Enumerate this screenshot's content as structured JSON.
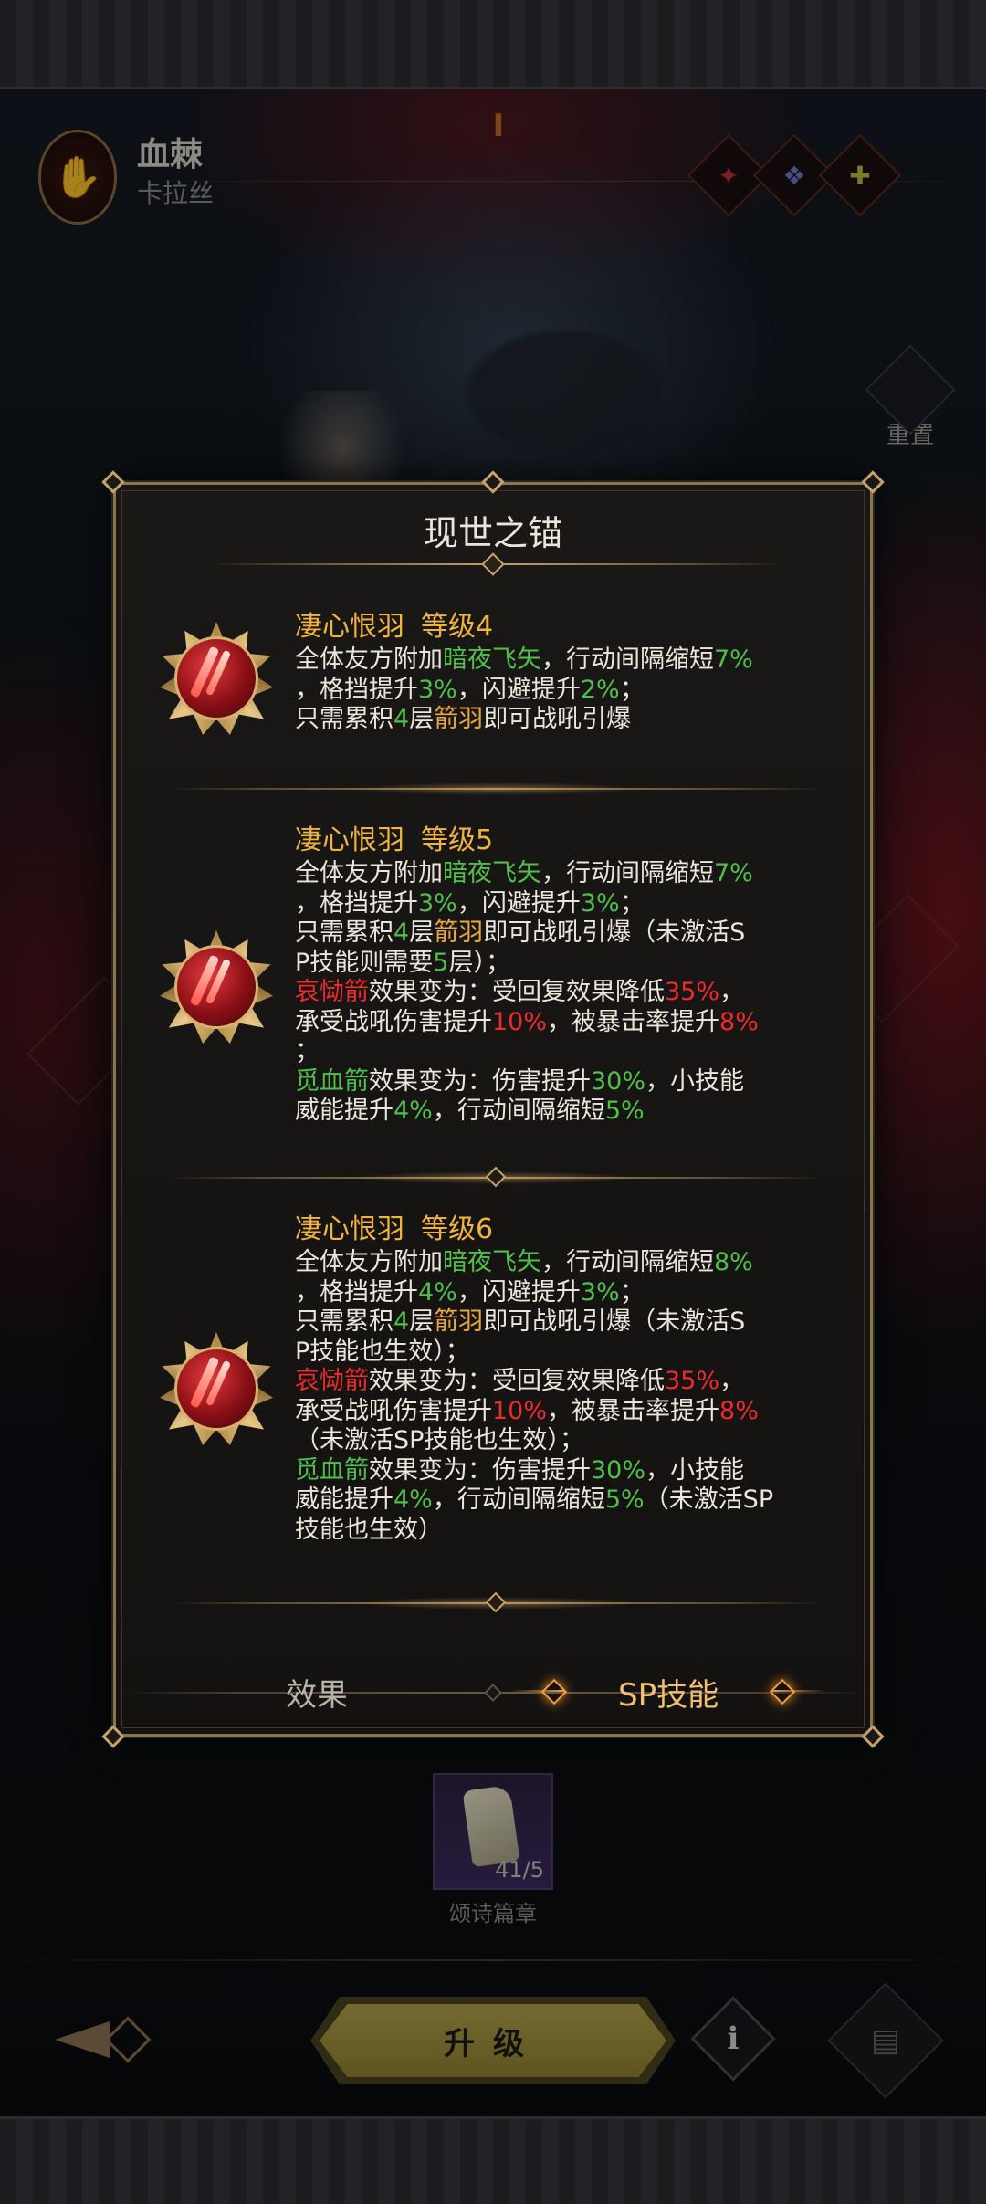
{
  "header": {
    "hero_emblem_icon": "red-hand-icon",
    "hero_name": "血棘",
    "hero_subtitle": "卡拉丝",
    "rank_mark": "I",
    "class_icons": [
      "red-crest-icon",
      "blue-beast-icon",
      "green-figure-icon"
    ],
    "reset_label": "重置"
  },
  "modal": {
    "title": "现世之锚",
    "skills": [
      {
        "name": "凄心恨羽",
        "level": "等级4",
        "lines": [
          [
            {
              "t": "全体友方附加",
              "c": "w"
            },
            {
              "t": "暗夜飞矢",
              "c": "g"
            },
            {
              "t": "，行动间隔缩短",
              "c": "w"
            },
            {
              "t": "7%",
              "c": "g"
            }
          ],
          [
            {
              "t": "，格挡提升",
              "c": "w"
            },
            {
              "t": "3%",
              "c": "g"
            },
            {
              "t": "，闪避提升",
              "c": "w"
            },
            {
              "t": "2%",
              "c": "g"
            },
            {
              "t": "；",
              "c": "w"
            }
          ],
          [
            {
              "t": "只需累积",
              "c": "w"
            },
            {
              "t": "4",
              "c": "g"
            },
            {
              "t": "层",
              "c": "w"
            },
            {
              "t": "箭羽",
              "c": "o"
            },
            {
              "t": "即可战吼引爆",
              "c": "w"
            }
          ]
        ]
      },
      {
        "name": "凄心恨羽",
        "level": "等级5",
        "lines": [
          [
            {
              "t": "全体友方附加",
              "c": "w"
            },
            {
              "t": "暗夜飞矢",
              "c": "g"
            },
            {
              "t": "，行动间隔缩短",
              "c": "w"
            },
            {
              "t": "7%",
              "c": "g"
            }
          ],
          [
            {
              "t": "，格挡提升",
              "c": "w"
            },
            {
              "t": "3%",
              "c": "g"
            },
            {
              "t": "，闪避提升",
              "c": "w"
            },
            {
              "t": "3%",
              "c": "g"
            },
            {
              "t": "；",
              "c": "w"
            }
          ],
          [
            {
              "t": "只需累积",
              "c": "w"
            },
            {
              "t": "4",
              "c": "g"
            },
            {
              "t": "层",
              "c": "w"
            },
            {
              "t": "箭羽",
              "c": "o"
            },
            {
              "t": "即可战吼引爆（未激活S",
              "c": "w"
            }
          ],
          [
            {
              "t": "P技能则需要",
              "c": "w"
            },
            {
              "t": "5",
              "c": "g"
            },
            {
              "t": "层）；",
              "c": "w"
            }
          ],
          [
            {
              "t": "哀恸箭",
              "c": "r"
            },
            {
              "t": "效果变为：受回复效果降低",
              "c": "w"
            },
            {
              "t": "35%",
              "c": "r"
            },
            {
              "t": "，",
              "c": "w"
            }
          ],
          [
            {
              "t": "承受战吼伤害提升",
              "c": "w"
            },
            {
              "t": "10%",
              "c": "r"
            },
            {
              "t": "，被暴击率提升",
              "c": "w"
            },
            {
              "t": "8%",
              "c": "r"
            }
          ],
          [
            {
              "t": "；",
              "c": "w"
            }
          ],
          [
            {
              "t": "觅血箭",
              "c": "g"
            },
            {
              "t": "效果变为：伤害提升",
              "c": "w"
            },
            {
              "t": "30%",
              "c": "g"
            },
            {
              "t": "，小技能",
              "c": "w"
            }
          ],
          [
            {
              "t": "威能提升",
              "c": "w"
            },
            {
              "t": "4%",
              "c": "g"
            },
            {
              "t": "，行动间隔缩短",
              "c": "w"
            },
            {
              "t": "5%",
              "c": "g"
            }
          ]
        ]
      },
      {
        "name": "凄心恨羽",
        "level": "等级6",
        "lines": [
          [
            {
              "t": "全体友方附加",
              "c": "w"
            },
            {
              "t": "暗夜飞矢",
              "c": "g"
            },
            {
              "t": "，行动间隔缩短",
              "c": "w"
            },
            {
              "t": "8%",
              "c": "g"
            }
          ],
          [
            {
              "t": "，格挡提升",
              "c": "w"
            },
            {
              "t": "4%",
              "c": "g"
            },
            {
              "t": "，闪避提升",
              "c": "w"
            },
            {
              "t": "3%",
              "c": "g"
            },
            {
              "t": "；",
              "c": "w"
            }
          ],
          [
            {
              "t": "只需累积",
              "c": "w"
            },
            {
              "t": "4",
              "c": "g"
            },
            {
              "t": "层",
              "c": "w"
            },
            {
              "t": "箭羽",
              "c": "o"
            },
            {
              "t": "即可战吼引爆（未激活S",
              "c": "w"
            }
          ],
          [
            {
              "t": "P技能也生效）；",
              "c": "w"
            }
          ],
          [
            {
              "t": "哀恸箭",
              "c": "r"
            },
            {
              "t": "效果变为：受回复效果降低",
              "c": "w"
            },
            {
              "t": "35%",
              "c": "r"
            },
            {
              "t": "，",
              "c": "w"
            }
          ],
          [
            {
              "t": "承受战吼伤害提升",
              "c": "w"
            },
            {
              "t": "10%",
              "c": "r"
            },
            {
              "t": "，被暴击率提升",
              "c": "w"
            },
            {
              "t": "8%",
              "c": "r"
            }
          ],
          [
            {
              "t": "（未激活SP技能也生效）；",
              "c": "w"
            }
          ],
          [
            {
              "t": "觅血箭",
              "c": "g"
            },
            {
              "t": "效果变为：伤害提升",
              "c": "w"
            },
            {
              "t": "30%",
              "c": "g"
            },
            {
              "t": "，小技能",
              "c": "w"
            }
          ],
          [
            {
              "t": "威能提升",
              "c": "w"
            },
            {
              "t": "4%",
              "c": "g"
            },
            {
              "t": "，行动间隔缩短",
              "c": "w"
            },
            {
              "t": "5%",
              "c": "g"
            },
            {
              "t": "（未激活SP",
              "c": "w"
            }
          ],
          [
            {
              "t": "技能也生效）",
              "c": "w"
            }
          ]
        ]
      }
    ],
    "tabs": {
      "effect": "效果",
      "sp": "SP技能",
      "active": "sp"
    }
  },
  "material": {
    "icon": "scroll-fragment-icon",
    "count": "41/5",
    "name": "颂诗篇章"
  },
  "footer": {
    "upgrade_label": "升级",
    "info_label": "i",
    "info_icon": "info-icon",
    "scroll_icon": "scroll-icon",
    "back_icon": "back-arrow-icon"
  },
  "colors": {
    "highlight_green": "#4fc04a",
    "highlight_red": "#ee2a2a",
    "highlight_orange": "#e6a640",
    "title_gold": "#f0b43c"
  }
}
